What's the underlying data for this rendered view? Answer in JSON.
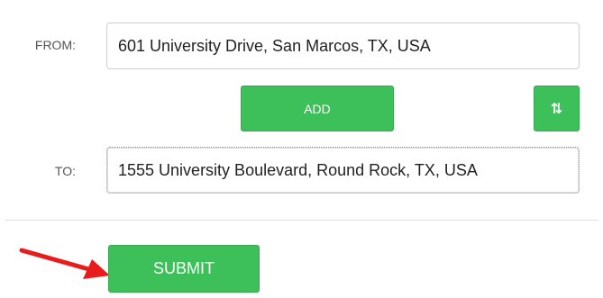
{
  "form": {
    "from_label": "FROM:",
    "from_value": "601 University Drive, San Marcos, TX, USA",
    "to_label": "TO:",
    "to_value": "1555 University Boulevard, Round Rock, TX, USA"
  },
  "buttons": {
    "add_label": "ADD",
    "swap_icon_glyph": "⇅",
    "swap_icon": "swap-vertical-icon",
    "submit_label": "SUBMIT"
  },
  "annotation": {
    "arrow_color": "#e81c1c",
    "arrow_icon": "red-arrow-icon"
  },
  "colors": {
    "button_green": "#3dbf5a"
  }
}
